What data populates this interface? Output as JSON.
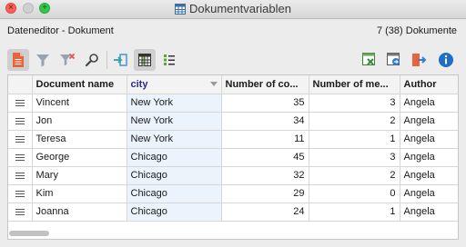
{
  "window": {
    "title": "Dokumentvariablen"
  },
  "header": {
    "left_label": "Dateneditor - Dokument",
    "right_label": "7 (38) Dokumente"
  },
  "toolbar": {
    "left_icons": [
      "document-icon",
      "filter-icon",
      "remove-filter-icon",
      "search-icon",
      "export-arrow-icon",
      "grid-view-icon",
      "list-view-icon"
    ],
    "right_icons": [
      "excel-export-icon",
      "settings-export-icon",
      "exit-icon",
      "info-icon"
    ]
  },
  "table": {
    "columns": [
      "Document name",
      "city",
      "Number of co...",
      "Number of me...",
      "Author"
    ],
    "sorted_column": "city",
    "rows": [
      [
        "Vincent",
        "New York",
        "35",
        "3",
        "Angela"
      ],
      [
        "Jon",
        "New York",
        "34",
        "2",
        "Angela"
      ],
      [
        "Teresa",
        "New York",
        "11",
        "1",
        "Angela"
      ],
      [
        "George",
        "Chicago",
        "45",
        "3",
        "Angela"
      ],
      [
        "Mary",
        "Chicago",
        "32",
        "2",
        "Angela"
      ],
      [
        "Kim",
        "Chicago",
        "29",
        "0",
        "Angela"
      ],
      [
        "Joanna",
        "Chicago",
        "24",
        "1",
        "Angela"
      ]
    ]
  },
  "colors": {
    "accent_blue": "#1f6fc5",
    "city_column_bg": "#ebf4fd",
    "doc_icon_orange": "#e8643a",
    "active_tool_bg": "#cfcfcf"
  }
}
